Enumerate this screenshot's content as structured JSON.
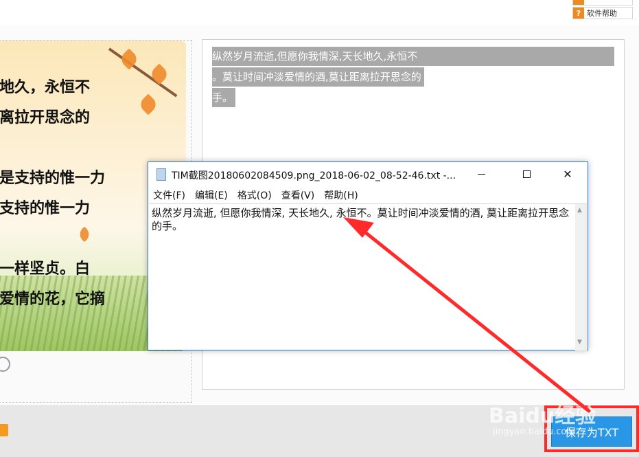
{
  "top": {
    "help_icon": "?",
    "help_label": "软件帮助"
  },
  "left_image": {
    "lines": [
      "地久，永恒不",
      "离拉开思念的",
      "是支持的惟一力",
      "支持的惟一力",
      "一样坚贞。白",
      "爱情的花，它摘"
    ]
  },
  "ocr_result": {
    "lines": [
      "纵然岁月流逝,但愿你我情深,天长地久,永恒不",
      "。莫让时间冲淡爱情的酒,莫让距离拉开思念的",
      "手。"
    ]
  },
  "notepad": {
    "title": "TIM截图20180602084509.png_2018-06-02_08-52-46.txt -...",
    "menu": [
      "文件(F)",
      "编辑(E)",
      "格式(O)",
      "查看(V)",
      "帮助(H)"
    ],
    "content": "纵然岁月流逝, 但愿你我情深, 天长地久, 永恒不。莫让时间冲淡爱情的酒, 莫让距离拉开思念的手。",
    "close_glyph": "✕"
  },
  "bottom": {
    "save_label": "保存为TXT",
    "watermark": "Baidu经验",
    "watermark_url": "jingyan.baidu.com"
  },
  "colors": {
    "accent": "#2a97e6",
    "highlight": "#ff2b2b",
    "orange": "#ef8b1e"
  }
}
